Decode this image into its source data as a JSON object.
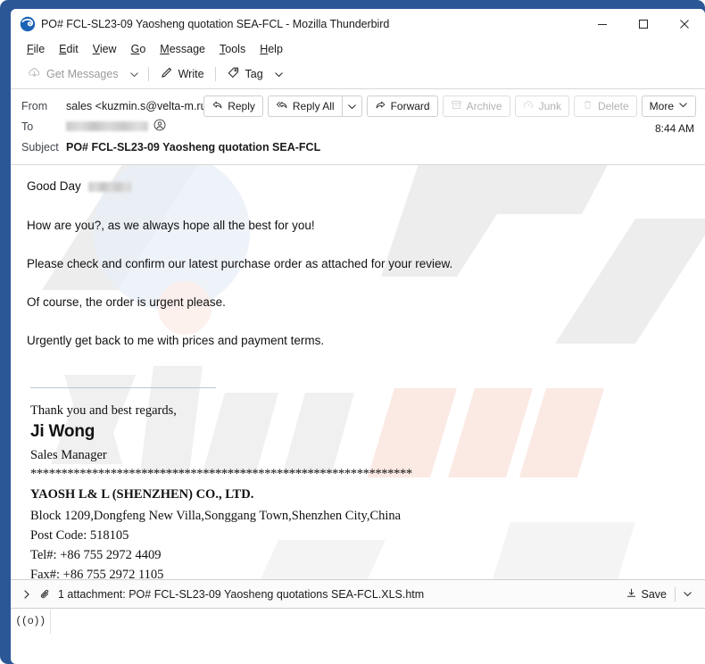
{
  "window": {
    "title": "PO# FCL-SL23-09 Yaosheng quotation SEA-FCL - Mozilla Thunderbird",
    "border_color": "#2b5797",
    "controls": {
      "minimize": "minimize-icon",
      "maximize": "maximize-icon",
      "close": "close-icon"
    }
  },
  "menubar": {
    "items": [
      {
        "label": "File",
        "accesskey": "F"
      },
      {
        "label": "Edit",
        "accesskey": "E"
      },
      {
        "label": "View",
        "accesskey": "V"
      },
      {
        "label": "Go",
        "accesskey": "G"
      },
      {
        "label": "Message",
        "accesskey": "M"
      },
      {
        "label": "Tools",
        "accesskey": "T"
      },
      {
        "label": "Help",
        "accesskey": "H"
      }
    ]
  },
  "toolbar": {
    "get_messages": "Get Messages",
    "get_messages_enabled": false,
    "write": "Write",
    "tag": "Tag"
  },
  "header": {
    "from_label": "From",
    "from_value": "sales <kuzmin.s@velta-m.ru>",
    "to_label": "To",
    "to_value_redacted": true,
    "subject_label": "Subject",
    "subject_value": "PO# FCL-SL23-09 Yaosheng quotation SEA-FCL",
    "timestamp": "8:44 AM",
    "actions": [
      {
        "label": "Reply",
        "icon": "reply-icon",
        "enabled": true
      },
      {
        "label": "Reply All",
        "icon": "reply-all-icon",
        "enabled": true
      },
      {
        "label": "Forward",
        "icon": "forward-icon",
        "enabled": true
      },
      {
        "label": "Archive",
        "icon": "archive-icon",
        "enabled": false
      },
      {
        "label": "Junk",
        "icon": "junk-icon",
        "enabled": false
      },
      {
        "label": "Delete",
        "icon": "trash-icon",
        "enabled": false
      },
      {
        "label": "More",
        "icon": "chevron-down-icon",
        "enabled": true
      }
    ]
  },
  "body": {
    "paragraphs": [
      "Good Day",
      "How are you?, as we always hope all the best for you!",
      "Please check and confirm our latest purchase order as attached for your review.",
      "Of course, the order is urgent please.",
      "Urgently get back to me with prices and payment terms."
    ],
    "greeting_has_redacted_name": true,
    "signature": {
      "closing": "Thank you and best regards,",
      "name": "Ji Wong",
      "job_title": "Sales Manager",
      "divider": "**************************************************************",
      "company": "YAOSH L& L (SHENZHEN) CO., LTD.",
      "address": "Block 1209,Dongfeng New Villa,Songgang Town,Shenzhen City,China",
      "post_code": "Post Code: 518105",
      "tel": "Tel#:  +86 755 2972 4409",
      "fax": "Fax#: +86 755 2972 1105"
    }
  },
  "attachment": {
    "summary": "1 attachment: PO# FCL-SL23-09 Yaosheng quotations SEA-FCL.XLS.htm",
    "save_label": "Save"
  },
  "statusbar": {
    "indicator": "((o))"
  }
}
